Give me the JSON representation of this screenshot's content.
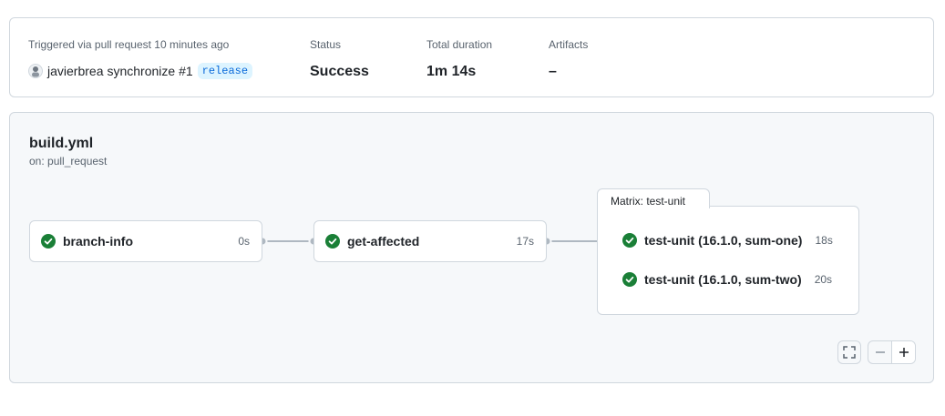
{
  "summary": {
    "trigger_label": "Triggered via pull request 10 minutes ago",
    "actor": "javierbrea",
    "event_text": "synchronize #1",
    "branch": "release",
    "status_label": "Status",
    "status_value": "Success",
    "duration_label": "Total duration",
    "duration_value": "1m 14s",
    "artifacts_label": "Artifacts",
    "artifacts_value": "–"
  },
  "workflow": {
    "file": "build.yml",
    "trigger": "on: pull_request",
    "jobs": [
      {
        "name": "branch-info",
        "duration": "0s",
        "status": "success"
      },
      {
        "name": "get-affected",
        "duration": "17s",
        "status": "success"
      }
    ],
    "matrix": {
      "label": "Matrix: test-unit",
      "items": [
        {
          "name": "test-unit (16.1.0, sum-one)",
          "duration": "18s",
          "status": "success"
        },
        {
          "name": "test-unit (16.1.0, sum-two)",
          "duration": "20s",
          "status": "success"
        }
      ]
    }
  },
  "controls": {
    "fullscreen_icon": "fullscreen-icon",
    "zoom_out_icon": "minus-icon",
    "zoom_in_icon": "plus-icon"
  },
  "colors": {
    "success": "#1a7f37",
    "border": "#d0d7de",
    "muted": "#59636e",
    "canvas": "#f6f8fa"
  }
}
